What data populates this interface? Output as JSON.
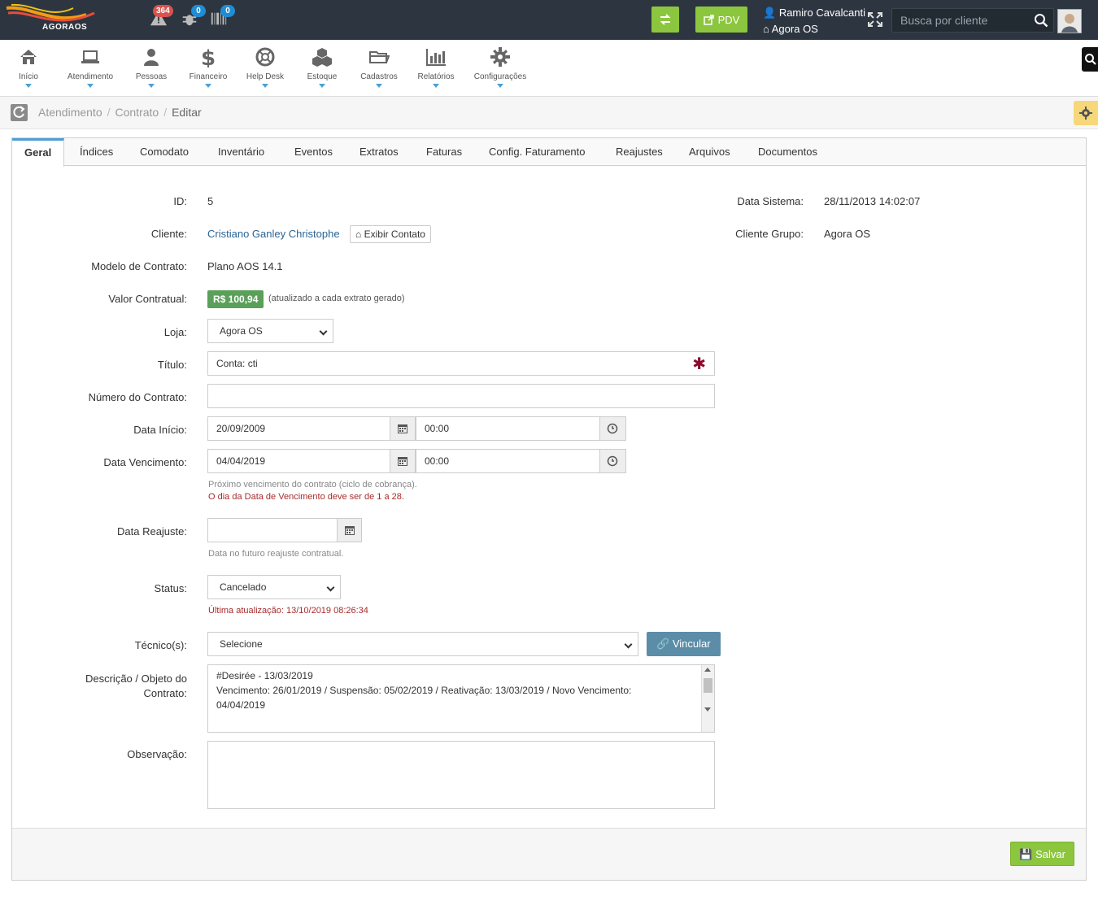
{
  "header": {
    "logo_text": "AGORAOS",
    "alerts_count": "364",
    "bugs_count": "0",
    "barcode_count": "0",
    "pdv_label": "PDV",
    "user_name": "Ramiro Cavalcanti",
    "company_name": "Agora OS",
    "search_placeholder": "Busca por cliente"
  },
  "nav": {
    "items": [
      {
        "label": "Início",
        "icon": "home-icon"
      },
      {
        "label": "Atendimento",
        "icon": "laptop-icon"
      },
      {
        "label": "Pessoas",
        "icon": "user-icon"
      },
      {
        "label": "Financeiro",
        "icon": "dollar-icon"
      },
      {
        "label": "Help Desk",
        "icon": "lifebuoy-icon"
      },
      {
        "label": "Estoque",
        "icon": "cubes-icon"
      },
      {
        "label": "Cadastros",
        "icon": "folder-icon"
      },
      {
        "label": "Relatórios",
        "icon": "bar-chart-icon"
      },
      {
        "label": "Configurações",
        "icon": "gear-icon"
      }
    ]
  },
  "breadcrumb": {
    "items": [
      "Atendimento",
      "Contrato",
      "Editar"
    ]
  },
  "tabs": [
    "Geral",
    "Índices",
    "Comodato",
    "Inventário",
    "Eventos",
    "Extratos",
    "Faturas",
    "Config. Faturamento",
    "Reajustes",
    "Arquivos",
    "Documentos"
  ],
  "form": {
    "id_label": "ID:",
    "id_value": "5",
    "cliente_label": "Cliente:",
    "cliente_value": "Cristiano Ganley Christophe",
    "exibir_contato_label": "Exibir Contato",
    "modelo_label": "Modelo de Contrato:",
    "modelo_value": "Plano AOS 14.1",
    "valor_label": "Valor Contratual:",
    "valor_value": "R$ 100,94",
    "valor_note": "(atualizado a cada extrato gerado)",
    "loja_label": "Loja:",
    "loja_value": "Agora OS",
    "titulo_label": "Título:",
    "titulo_value": "Conta: cti",
    "numero_label": "Número do Contrato:",
    "numero_value": "",
    "data_inicio_label": "Data Início:",
    "data_inicio_date": "20/09/2009",
    "data_inicio_time": "00:00",
    "data_venc_label": "Data Vencimento:",
    "data_venc_date": "04/04/2019",
    "data_venc_time": "00:00",
    "data_venc_help": "Próximo vencimento do contrato (ciclo de cobrança).",
    "data_venc_error": "O dia da Data de Vencimento deve ser de 1 a 28.",
    "data_reajuste_label": "Data Reajuste:",
    "data_reajuste_value": "",
    "data_reajuste_help": "Data no futuro reajuste contratual.",
    "status_label": "Status:",
    "status_value": "Cancelado",
    "status_note": "Última atualização: 13/10/2019 08:26:34",
    "tecnico_label": "Técnico(s):",
    "tecnico_value": "Selecione",
    "vincular_label": "Vincular",
    "descricao_label_1": "Descrição / Objeto do",
    "descricao_label_2": "Contrato:",
    "descricao_line1": "#Desirée - 13/03/2019",
    "descricao_line2": "Vencimento: 26/01/2019 / Suspensão: 05/02/2019 / Reativação: 13/03/2019 / Novo Vencimento:",
    "descricao_line3": "04/04/2019",
    "observacao_label": "Observação:",
    "observacao_value": "",
    "data_sistema_label": "Data Sistema:",
    "data_sistema_value": "28/11/2013 14:02:07",
    "cliente_grupo_label": "Cliente Grupo:",
    "cliente_grupo_value": "Agora OS",
    "salvar_label": "Salvar"
  }
}
